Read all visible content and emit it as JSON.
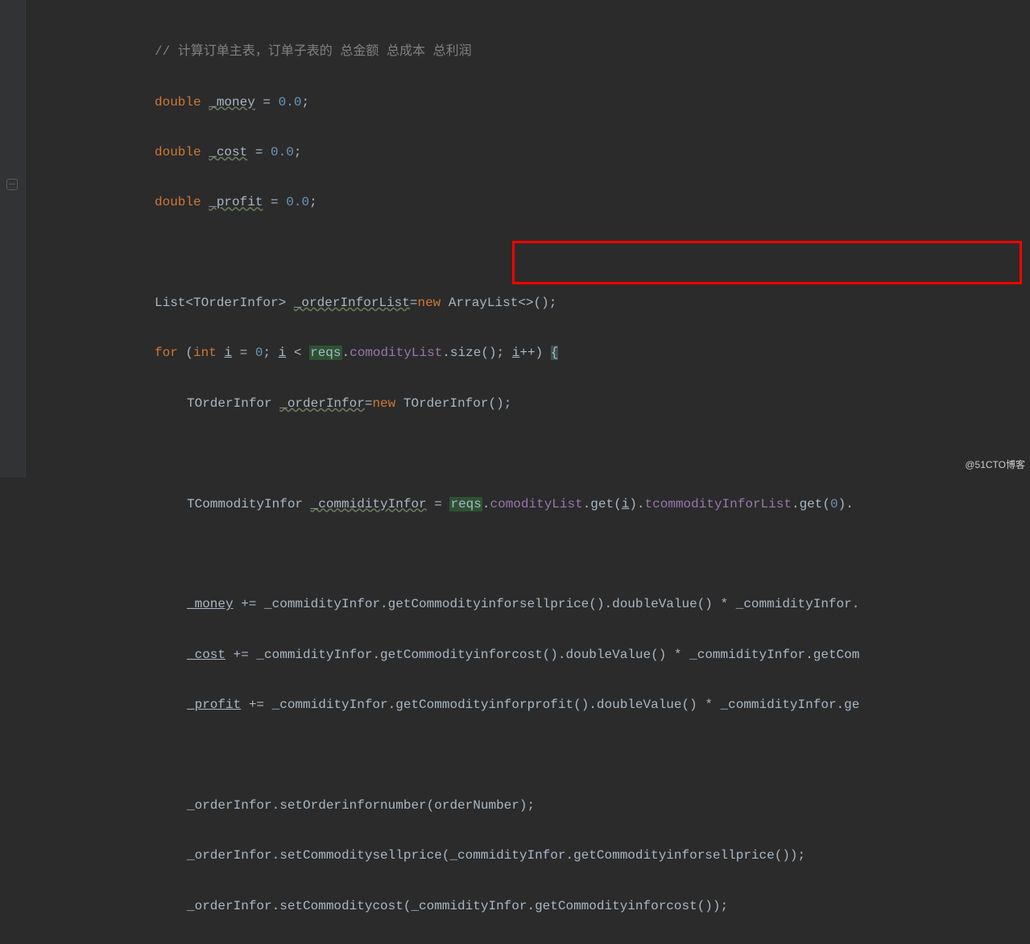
{
  "gutter": {
    "collapse_icon": "collapse"
  },
  "code": {
    "line1": {
      "comment": "// 计算订单主表，订单子表的 总金额 总成本 总利润"
    },
    "line2": {
      "kw": "double",
      "var": "_money",
      "eq": " = ",
      "val": "0.0",
      "end": ";"
    },
    "line3": {
      "kw": "double",
      "var": "_cost",
      "eq": " = ",
      "val": "0.0",
      "end": ";"
    },
    "line4": {
      "kw": "double",
      "var": "_profit",
      "eq": " = ",
      "val": "0.0",
      "end": ";"
    },
    "line5": {
      "t1": "List<TOrderInfor> ",
      "var": "_orderInforList",
      "t2": "=",
      "kw": "new",
      "t3": " ArrayList<>();"
    },
    "line6": {
      "kw1": "for",
      "t1": " (",
      "kw2": "int",
      "t2": " ",
      "var1": "i",
      "t3": " = ",
      "val": "0",
      "t4": "; ",
      "var2": "i",
      "t5": " < ",
      "reqs": "reqs",
      "t6": ".",
      "field1": "comodityList",
      "t7": ".size(); ",
      "var3": "i",
      "t8": "++) ",
      "brace": "{"
    },
    "line7": {
      "t1": "TOrderInfor ",
      "var": "_orderInfor",
      "t2": "=",
      "kw": "new",
      "t3": " TOrderInfor();"
    },
    "line8": {
      "t1": "TCommodityInfor ",
      "var": "_commidityInfor",
      "t2": " = ",
      "reqs": "reqs",
      "t3": ".",
      "field1": "comodityList",
      "t4": ".get(",
      "var2": "i",
      "t5": ").",
      "field2": "tcommodityInforList",
      "t6": ".get(",
      "val": "0",
      "t7": ")."
    },
    "line9": {
      "var": "_money",
      "t1": " += _commidityInfor.getCommodityinforsellprice().doubleValue() * _commidityInfor."
    },
    "line10": {
      "var": "_cost",
      "t1": " += _commidityInfor.getCommodityinforcost().doubleValue() * _commidityInfor.getCom"
    },
    "line11": {
      "var": "_profit",
      "t1": " += _commidityInfor.getCommodityinforprofit().doubleValue() * _commidityInfor.ge"
    },
    "line12": {
      "t1": "_orderInfor.setOrderinfornumber(orderNumber);"
    },
    "line13": {
      "t1": "_orderInfor.setCommoditysellprice(_commidityInfor.getCommodityinforsellprice());"
    },
    "line14": {
      "t1": "_orderInfor.setCommoditycost(_commidityInfor.getCommodityinforcost());"
    }
  },
  "watermark": "@51CTO博客"
}
